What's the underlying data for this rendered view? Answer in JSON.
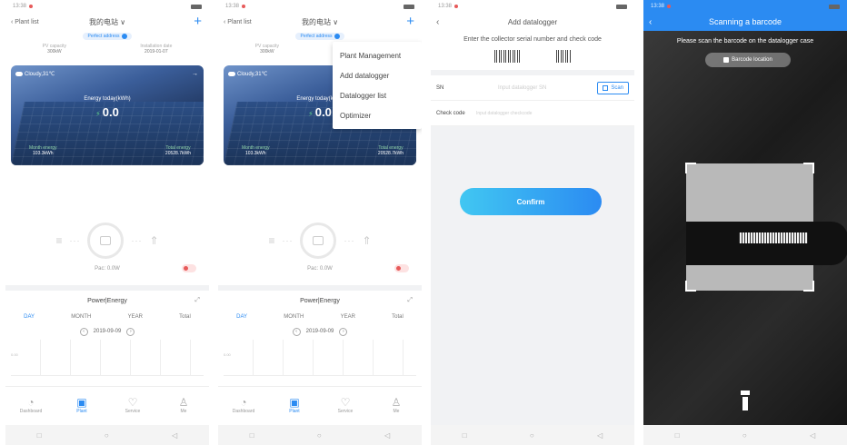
{
  "status": {
    "time": "13:38"
  },
  "plant": {
    "back_label": "Plant list",
    "title": "我的电站",
    "title_arrow": "∨",
    "badge": "Perfect address",
    "pv_capacity_label": "PV capacity",
    "pv_capacity_value": "300kW",
    "install_date_label": "Installation date",
    "install_date_value": "2019-01-07",
    "weather": "Cloudy,31℃",
    "energy_today_label": "Energy today(kWh)",
    "energy_today_value": "0.0",
    "month_energy_label": "Month energy",
    "month_energy_value": "103.3kWh",
    "total_energy_label": "Total energy",
    "total_energy_value": "20528.7kWh",
    "pac": "Pac: 0.0W",
    "power_energy_title": "Power|Energy",
    "tabs": [
      "DAY",
      "MONTH",
      "YEAR",
      "Total"
    ],
    "date": "2019-09-09",
    "chart_zero_label": "0.00"
  },
  "tabbar": {
    "items": [
      {
        "label": "Dashboard",
        "icon": "dashboard-icon"
      },
      {
        "label": "Plant",
        "icon": "plant-icon"
      },
      {
        "label": "Service",
        "icon": "service-icon"
      },
      {
        "label": "Me",
        "icon": "me-icon"
      }
    ]
  },
  "menu": {
    "items": [
      "Plant Management",
      "Add datalogger",
      "Datalogger list",
      "Optimizer"
    ]
  },
  "add_datalogger": {
    "title": "Add datalogger",
    "instruction": "Enter the collector serial number and check code",
    "sn_label": "SN",
    "sn_placeholder": "Input datalogger SN",
    "scan_label": "Scan",
    "checkcode_label": "Check code",
    "checkcode_placeholder": "Input datalogger checkcode",
    "confirm_label": "Confirm"
  },
  "scan_screen": {
    "title": "Scanning a barcode",
    "message": "Please scan the barcode on the datalogger case",
    "barcode_location": "Barcode location"
  },
  "colors": {
    "accent": "#2b8bf2",
    "confirm_start": "#41c7f2",
    "green": "#5fd28a"
  }
}
